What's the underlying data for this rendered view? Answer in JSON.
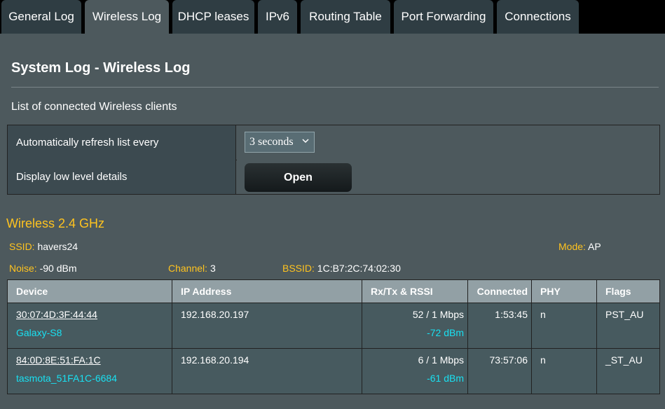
{
  "tabs": [
    {
      "label": "General Log",
      "active": false
    },
    {
      "label": "Wireless Log",
      "active": true
    },
    {
      "label": "DHCP leases",
      "active": false
    },
    {
      "label": "IPv6",
      "active": false
    },
    {
      "label": "Routing Table",
      "active": false
    },
    {
      "label": "Port Forwarding",
      "active": false
    },
    {
      "label": "Connections",
      "active": false
    }
  ],
  "page": {
    "title": "System Log - Wireless Log",
    "subtitle": "List of connected Wireless clients"
  },
  "settings": {
    "refresh_label": "Automatically refresh list every",
    "refresh_value": "3 seconds",
    "details_label": "Display low level details",
    "open_button": "Open"
  },
  "wireless": {
    "heading": "Wireless 2.4 GHz",
    "ssid_label": "SSID:",
    "ssid": "havers24",
    "mode_label": "Mode:",
    "mode": "AP",
    "noise_label": "Noise:",
    "noise": "-90 dBm",
    "channel_label": "Channel:",
    "channel": "3",
    "bssid_label": "BSSID:",
    "bssid": "1C:B7:2C:74:02:30"
  },
  "table": {
    "headers": {
      "device": "Device",
      "ip": "IP Address",
      "rxtx": "Rx/Tx & RSSI",
      "connected": "Connected",
      "phy": "PHY",
      "flags": "Flags"
    },
    "rows": [
      {
        "mac": "30:07:4D:3F:44:44",
        "name": "Galaxy-S8",
        "ip": "192.168.20.197",
        "rate": "52 / 1 Mbps",
        "rssi": "-72 dBm",
        "connected": "1:53:45",
        "phy": "n",
        "flags": "PST_AU"
      },
      {
        "mac": "84:0D:8E:51:FA:1C",
        "name": "tasmota_51FA1C-6684",
        "ip": "192.168.20.194",
        "rate": "6 / 1 Mbps",
        "rssi": "-61 dBm",
        "connected": "73:57:06",
        "phy": "n",
        "flags": "_ST_AU"
      }
    ]
  },
  "colors": {
    "accent_yellow": "#ffc31f",
    "accent_cyan": "#19e0f1",
    "page_bg": "#4d595d"
  }
}
